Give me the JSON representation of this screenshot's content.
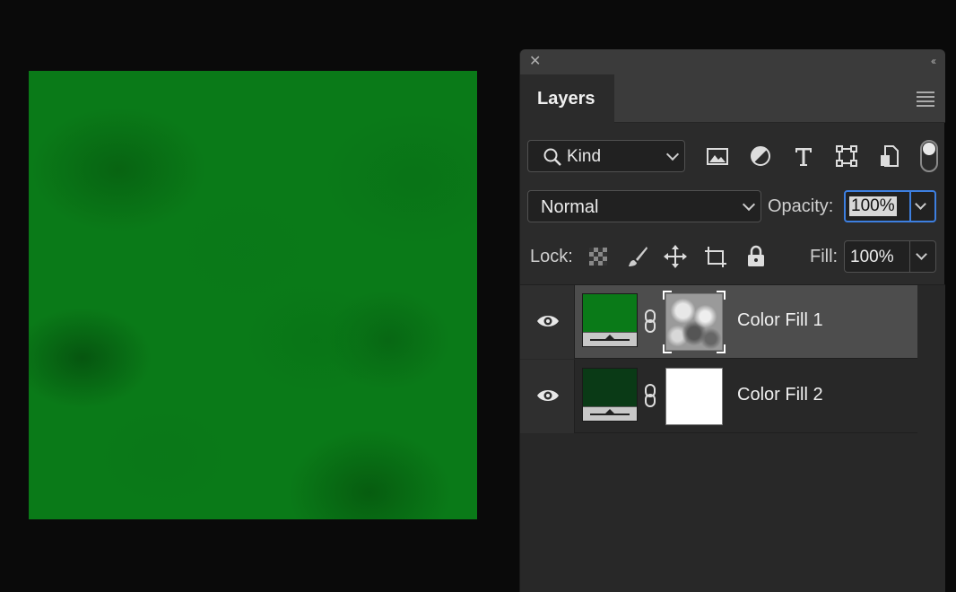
{
  "canvas": {
    "fill_color": "#0a7a18"
  },
  "panel": {
    "close_icon": "close-icon",
    "collapse_icon": "double-chevron-left-icon",
    "tab_title": "Layers",
    "menu_icon": "panel-menu-icon"
  },
  "filter": {
    "kind_label": "Kind",
    "icons": [
      "image-filter-icon",
      "adjustment-filter-icon",
      "type-filter-icon",
      "shape-filter-icon",
      "smart-object-filter-icon"
    ]
  },
  "blend": {
    "mode": "Normal",
    "opacity_label": "Opacity:",
    "opacity_value": "100%"
  },
  "lock": {
    "label": "Lock:",
    "icons": [
      "lock-transparent-icon",
      "lock-image-icon",
      "lock-position-icon",
      "lock-artboard-icon",
      "lock-all-icon"
    ],
    "fill_label": "Fill:",
    "fill_value": "100%"
  },
  "layers": [
    {
      "name": "Color Fill 1",
      "color": "#0a7a18",
      "mask": "noise",
      "selected": true
    },
    {
      "name": "Color Fill 2",
      "color": "#0a3a16",
      "mask": "white",
      "selected": false
    }
  ]
}
